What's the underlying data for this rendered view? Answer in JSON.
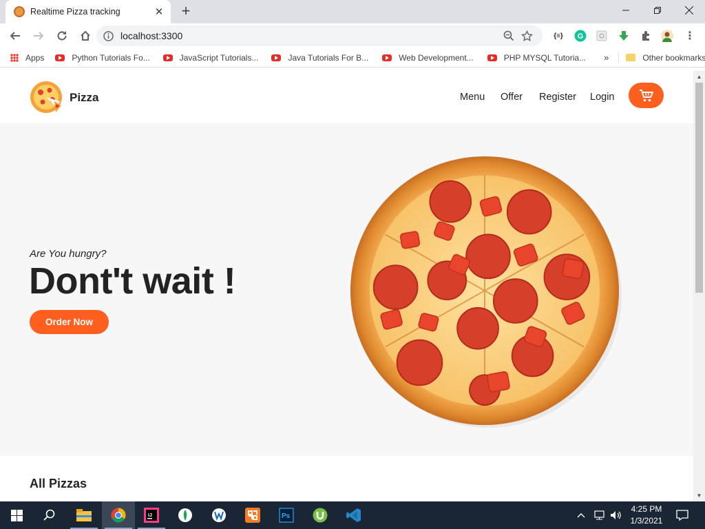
{
  "browser": {
    "tab_title": "Realtime Pizza tracking",
    "new_tab": "+",
    "url": "localhost:3300",
    "bookmarks": [
      {
        "label": "Apps",
        "icon": "apps-grid-icon"
      },
      {
        "label": "Python Tutorials Fo...",
        "icon": "youtube-icon"
      },
      {
        "label": "JavaScript Tutorials...",
        "icon": "youtube-icon"
      },
      {
        "label": "Java Tutorials For B...",
        "icon": "youtube-icon"
      },
      {
        "label": "Web Development...",
        "icon": "youtube-icon"
      },
      {
        "label": "PHP MYSQL Tutoria...",
        "icon": "youtube-icon"
      }
    ],
    "more_bookmarks": "»",
    "other_bookmarks": "Other bookmarks"
  },
  "site": {
    "brand": "Pizza",
    "nav": [
      "Menu",
      "Offer",
      "Register",
      "Login"
    ],
    "accent_color": "#fe5f1e",
    "hero": {
      "subtitle": "Are You hungry?",
      "title": "Dont't wait !",
      "cta": "Order Now"
    },
    "section_title": "All Pizzas"
  },
  "taskbar": {
    "apps": [
      "windows-start-icon",
      "search-icon",
      "file-explorer-icon",
      "chrome-icon",
      "intellij-icon",
      "mongodb-icon",
      "app-icon",
      "xampp-icon",
      "photoshop-icon",
      "utorrent-icon",
      "vscode-icon"
    ],
    "time": "4:25 PM",
    "date": "1/3/2021"
  }
}
